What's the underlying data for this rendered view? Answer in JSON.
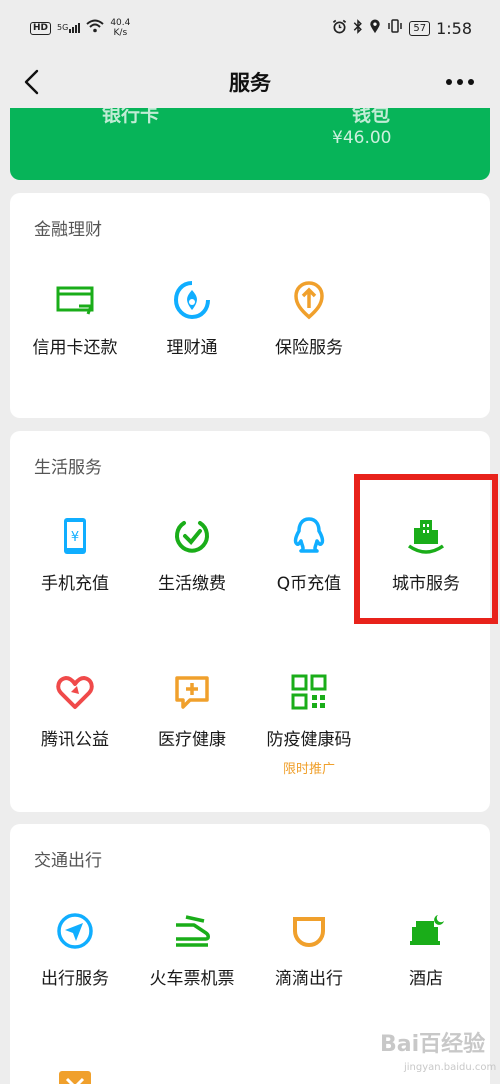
{
  "status_bar": {
    "hd": "HD",
    "signal": "5G",
    "speed_value": "40.4",
    "speed_unit": "K/s",
    "battery": "57",
    "time": "1:58"
  },
  "nav": {
    "title": "服务"
  },
  "wallet": {
    "left_label": "银行卡",
    "right_label": "钱包",
    "balance": "¥46.00"
  },
  "finance": {
    "title": "金融理财",
    "items": [
      {
        "label": "信用卡还款",
        "icon": "credit-card-icon"
      },
      {
        "label": "理财通",
        "icon": "wealth-icon"
      },
      {
        "label": "保险服务",
        "icon": "insurance-icon"
      }
    ]
  },
  "life": {
    "title": "生活服务",
    "items": [
      {
        "label": "手机充值",
        "icon": "phone-topup-icon"
      },
      {
        "label": "生活缴费",
        "icon": "utility-bill-icon"
      },
      {
        "label": "Q币充值",
        "icon": "qq-coin-icon"
      },
      {
        "label": "城市服务",
        "icon": "city-service-icon"
      },
      {
        "label": "腾讯公益",
        "icon": "charity-icon"
      },
      {
        "label": "医疗健康",
        "icon": "medical-icon"
      },
      {
        "label": "防疫健康码",
        "icon": "qr-code-icon",
        "badge": "限时推广"
      }
    ]
  },
  "transport": {
    "title": "交通出行",
    "items": [
      {
        "label": "出行服务",
        "icon": "navigation-icon"
      },
      {
        "label": "火车票机票",
        "icon": "train-icon"
      },
      {
        "label": "滴滴出行",
        "icon": "didi-icon"
      },
      {
        "label": "酒店",
        "icon": "hotel-icon"
      }
    ]
  },
  "watermark": {
    "main": "Bai百经验",
    "sub": "jingyan.baidu.com"
  },
  "colors": {
    "brand_green": "#07b459",
    "icon_green": "#1aad19",
    "icon_blue": "#10aeff",
    "icon_orange": "#f0a02c",
    "icon_red": "#f04a4a",
    "highlight_red": "#e8221b"
  }
}
